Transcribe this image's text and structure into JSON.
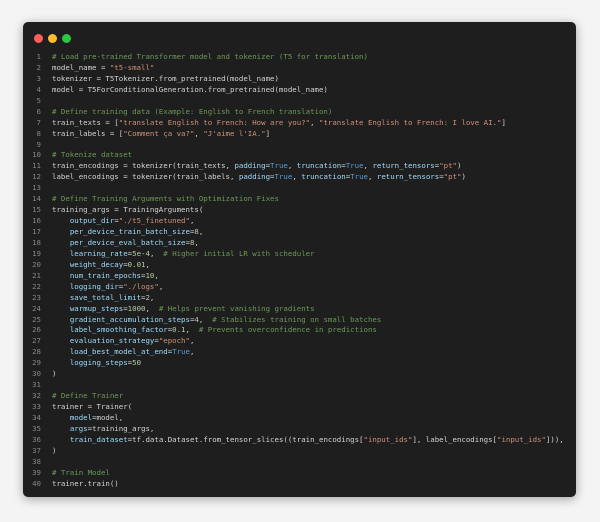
{
  "window": {
    "controls": {
      "close": "close-control",
      "minimize": "minimize-control",
      "zoom": "zoom-control",
      "close_color": "#ff5f57",
      "minimize_color": "#febc2e",
      "zoom_color": "#28c840"
    }
  },
  "code_lines": [
    {
      "num": "1",
      "tokens": [
        {
          "c": "c",
          "t": "# Load pre-trained Transformer model and tokenizer (T5 for translation)"
        }
      ]
    },
    {
      "num": "2",
      "tokens": [
        {
          "c": "t",
          "t": "model_name = "
        },
        {
          "c": "s",
          "t": "\"t5-small\""
        }
      ]
    },
    {
      "num": "3",
      "tokens": [
        {
          "c": "t",
          "t": "tokenizer = T5Tokenizer.from_pretrained(model_name)"
        }
      ]
    },
    {
      "num": "4",
      "tokens": [
        {
          "c": "t",
          "t": "model = T5ForConditionalGeneration.from_pretrained(model_name)"
        }
      ]
    },
    {
      "num": "5",
      "tokens": []
    },
    {
      "num": "6",
      "tokens": [
        {
          "c": "c",
          "t": "# Define training data (Example: English to French translation)"
        }
      ]
    },
    {
      "num": "7",
      "tokens": [
        {
          "c": "t",
          "t": "train_texts = ["
        },
        {
          "c": "s",
          "t": "\"translate English to French: How are you?\""
        },
        {
          "c": "t",
          "t": ", "
        },
        {
          "c": "s",
          "t": "\"translate English to French: I love AI.\""
        },
        {
          "c": "t",
          "t": "]"
        }
      ]
    },
    {
      "num": "8",
      "tokens": [
        {
          "c": "t",
          "t": "train_labels = ["
        },
        {
          "c": "s",
          "t": "\"Comment ça va?\""
        },
        {
          "c": "t",
          "t": ", "
        },
        {
          "c": "s",
          "t": "\"J'aime l'IA.\""
        },
        {
          "c": "t",
          "t": "]"
        }
      ]
    },
    {
      "num": "9",
      "tokens": []
    },
    {
      "num": "10",
      "tokens": [
        {
          "c": "c",
          "t": "# Tokenize dataset"
        }
      ]
    },
    {
      "num": "11",
      "tokens": [
        {
          "c": "t",
          "t": "train_encodings = tokenizer(train_texts, "
        },
        {
          "c": "a",
          "t": "padding"
        },
        {
          "c": "t",
          "t": "="
        },
        {
          "c": "k",
          "t": "True"
        },
        {
          "c": "t",
          "t": ", "
        },
        {
          "c": "a",
          "t": "truncation"
        },
        {
          "c": "t",
          "t": "="
        },
        {
          "c": "k",
          "t": "True"
        },
        {
          "c": "t",
          "t": ", "
        },
        {
          "c": "a",
          "t": "return_tensors"
        },
        {
          "c": "t",
          "t": "="
        },
        {
          "c": "s",
          "t": "\"pt\""
        },
        {
          "c": "t",
          "t": ")"
        }
      ]
    },
    {
      "num": "12",
      "tokens": [
        {
          "c": "t",
          "t": "label_encodings = tokenizer(train_labels, "
        },
        {
          "c": "a",
          "t": "padding"
        },
        {
          "c": "t",
          "t": "="
        },
        {
          "c": "k",
          "t": "True"
        },
        {
          "c": "t",
          "t": ", "
        },
        {
          "c": "a",
          "t": "truncation"
        },
        {
          "c": "t",
          "t": "="
        },
        {
          "c": "k",
          "t": "True"
        },
        {
          "c": "t",
          "t": ", "
        },
        {
          "c": "a",
          "t": "return_tensors"
        },
        {
          "c": "t",
          "t": "="
        },
        {
          "c": "s",
          "t": "\"pt\""
        },
        {
          "c": "t",
          "t": ")"
        }
      ]
    },
    {
      "num": "13",
      "tokens": []
    },
    {
      "num": "14",
      "tokens": [
        {
          "c": "c",
          "t": "# Define Training Arguments with Optimization Fixes"
        }
      ]
    },
    {
      "num": "15",
      "tokens": [
        {
          "c": "t",
          "t": "training_args = TrainingArguments("
        }
      ]
    },
    {
      "num": "16",
      "tokens": [
        {
          "c": "t",
          "t": "    "
        },
        {
          "c": "a",
          "t": "output_dir"
        },
        {
          "c": "t",
          "t": "="
        },
        {
          "c": "s",
          "t": "\"./t5_finetuned\""
        },
        {
          "c": "t",
          "t": ","
        }
      ]
    },
    {
      "num": "17",
      "tokens": [
        {
          "c": "t",
          "t": "    "
        },
        {
          "c": "a",
          "t": "per_device_train_batch_size"
        },
        {
          "c": "t",
          "t": "="
        },
        {
          "c": "n",
          "t": "8"
        },
        {
          "c": "t",
          "t": ","
        }
      ]
    },
    {
      "num": "18",
      "tokens": [
        {
          "c": "t",
          "t": "    "
        },
        {
          "c": "a",
          "t": "per_device_eval_batch_size"
        },
        {
          "c": "t",
          "t": "="
        },
        {
          "c": "n",
          "t": "8"
        },
        {
          "c": "t",
          "t": ","
        }
      ]
    },
    {
      "num": "19",
      "tokens": [
        {
          "c": "t",
          "t": "    "
        },
        {
          "c": "a",
          "t": "learning_rate"
        },
        {
          "c": "t",
          "t": "="
        },
        {
          "c": "n",
          "t": "5e-4"
        },
        {
          "c": "t",
          "t": ",  "
        },
        {
          "c": "c",
          "t": "# Higher initial LR with scheduler"
        }
      ]
    },
    {
      "num": "20",
      "tokens": [
        {
          "c": "t",
          "t": "    "
        },
        {
          "c": "a",
          "t": "weight_decay"
        },
        {
          "c": "t",
          "t": "="
        },
        {
          "c": "n",
          "t": "0.01"
        },
        {
          "c": "t",
          "t": ","
        }
      ]
    },
    {
      "num": "21",
      "tokens": [
        {
          "c": "t",
          "t": "    "
        },
        {
          "c": "a",
          "t": "num_train_epochs"
        },
        {
          "c": "t",
          "t": "="
        },
        {
          "c": "n",
          "t": "10"
        },
        {
          "c": "t",
          "t": ","
        }
      ]
    },
    {
      "num": "22",
      "tokens": [
        {
          "c": "t",
          "t": "    "
        },
        {
          "c": "a",
          "t": "logging_dir"
        },
        {
          "c": "t",
          "t": "="
        },
        {
          "c": "s",
          "t": "\"./logs\""
        },
        {
          "c": "t",
          "t": ","
        }
      ]
    },
    {
      "num": "23",
      "tokens": [
        {
          "c": "t",
          "t": "    "
        },
        {
          "c": "a",
          "t": "save_total_limit"
        },
        {
          "c": "t",
          "t": "="
        },
        {
          "c": "n",
          "t": "2"
        },
        {
          "c": "t",
          "t": ","
        }
      ]
    },
    {
      "num": "24",
      "tokens": [
        {
          "c": "t",
          "t": "    "
        },
        {
          "c": "a",
          "t": "warmup_steps"
        },
        {
          "c": "t",
          "t": "="
        },
        {
          "c": "n",
          "t": "1000"
        },
        {
          "c": "t",
          "t": ",  "
        },
        {
          "c": "c",
          "t": "# Helps prevent vanishing gradients"
        }
      ]
    },
    {
      "num": "25",
      "tokens": [
        {
          "c": "t",
          "t": "    "
        },
        {
          "c": "a",
          "t": "gradient_accumulation_steps"
        },
        {
          "c": "t",
          "t": "="
        },
        {
          "c": "n",
          "t": "4"
        },
        {
          "c": "t",
          "t": ",  "
        },
        {
          "c": "c",
          "t": "# Stabilizes training on small batches"
        }
      ]
    },
    {
      "num": "26",
      "tokens": [
        {
          "c": "t",
          "t": "    "
        },
        {
          "c": "a",
          "t": "label_smoothing_factor"
        },
        {
          "c": "t",
          "t": "="
        },
        {
          "c": "n",
          "t": "0.1"
        },
        {
          "c": "t",
          "t": ",  "
        },
        {
          "c": "c",
          "t": "# Prevents overconfidence in predictions"
        }
      ]
    },
    {
      "num": "27",
      "tokens": [
        {
          "c": "t",
          "t": "    "
        },
        {
          "c": "a",
          "t": "evaluation_strategy"
        },
        {
          "c": "t",
          "t": "="
        },
        {
          "c": "s",
          "t": "\"epoch\""
        },
        {
          "c": "t",
          "t": ","
        }
      ]
    },
    {
      "num": "28",
      "tokens": [
        {
          "c": "t",
          "t": "    "
        },
        {
          "c": "a",
          "t": "load_best_model_at_end"
        },
        {
          "c": "t",
          "t": "="
        },
        {
          "c": "k",
          "t": "True"
        },
        {
          "c": "t",
          "t": ","
        }
      ]
    },
    {
      "num": "29",
      "tokens": [
        {
          "c": "t",
          "t": "    "
        },
        {
          "c": "a",
          "t": "logging_steps"
        },
        {
          "c": "t",
          "t": "="
        },
        {
          "c": "n",
          "t": "50"
        }
      ]
    },
    {
      "num": "30",
      "tokens": [
        {
          "c": "t",
          "t": ")"
        }
      ]
    },
    {
      "num": "31",
      "tokens": []
    },
    {
      "num": "32",
      "tokens": [
        {
          "c": "c",
          "t": "# Define Trainer"
        }
      ]
    },
    {
      "num": "33",
      "tokens": [
        {
          "c": "t",
          "t": "trainer = Trainer("
        }
      ]
    },
    {
      "num": "34",
      "tokens": [
        {
          "c": "t",
          "t": "    "
        },
        {
          "c": "a",
          "t": "model"
        },
        {
          "c": "t",
          "t": "=model,"
        }
      ]
    },
    {
      "num": "35",
      "tokens": [
        {
          "c": "t",
          "t": "    "
        },
        {
          "c": "a",
          "t": "args"
        },
        {
          "c": "t",
          "t": "=training_args,"
        }
      ]
    },
    {
      "num": "36",
      "tokens": [
        {
          "c": "t",
          "t": "    "
        },
        {
          "c": "a",
          "t": "train_dataset"
        },
        {
          "c": "t",
          "t": "=tf.data.Dataset.from_tensor_slices((train_encodings["
        },
        {
          "c": "s",
          "t": "\"input_ids\""
        },
        {
          "c": "t",
          "t": "], label_encodings["
        },
        {
          "c": "s",
          "t": "\"input_ids\""
        },
        {
          "c": "t",
          "t": "])),"
        }
      ]
    },
    {
      "num": "37",
      "tokens": [
        {
          "c": "t",
          "t": ")"
        }
      ]
    },
    {
      "num": "38",
      "tokens": []
    },
    {
      "num": "39",
      "tokens": [
        {
          "c": "c",
          "t": "# Train Model"
        }
      ]
    },
    {
      "num": "40",
      "tokens": [
        {
          "c": "t",
          "t": "trainer.train()"
        }
      ]
    }
  ]
}
